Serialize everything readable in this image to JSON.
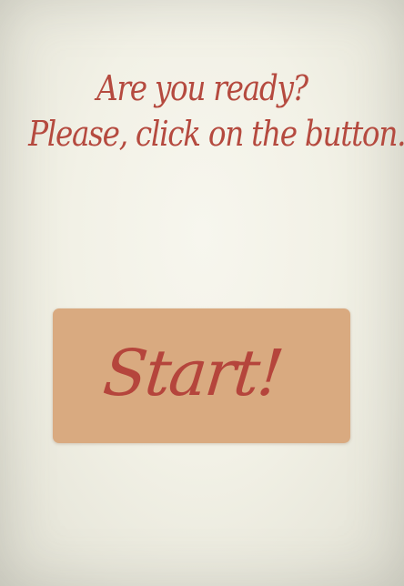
{
  "heading": {
    "line1": "Are you ready?",
    "line2": "Please, click on the button..."
  },
  "start_button": {
    "label": "Start!"
  },
  "colors": {
    "text_accent": "#b54a3f",
    "button_fill": "#d9aa80",
    "background": "#f3f2e8"
  }
}
